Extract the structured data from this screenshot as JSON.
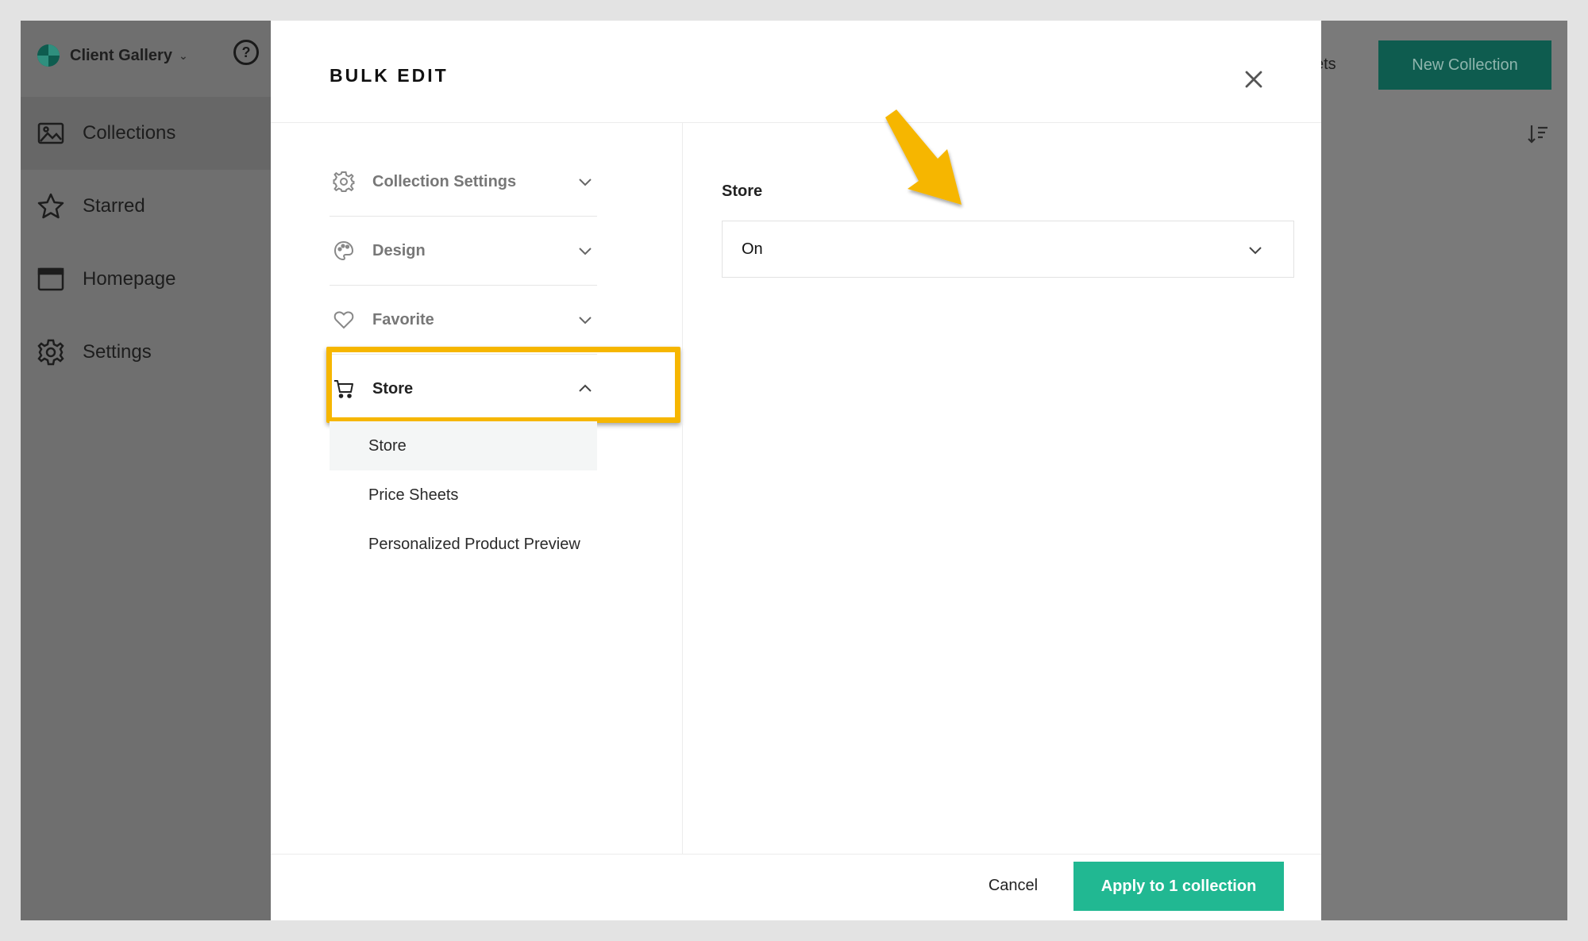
{
  "app": {
    "brand_name": "Client Gallery",
    "help_label": "?",
    "nav": [
      {
        "label": "Collections",
        "icon": "image-folder-icon",
        "active": true
      },
      {
        "label": "Starred",
        "icon": "star-icon",
        "active": false
      },
      {
        "label": "Homepage",
        "icon": "browser-window-icon",
        "active": false
      },
      {
        "label": "Settings",
        "icon": "gear-icon",
        "active": false
      }
    ],
    "top_partial_text": "ets",
    "new_collection_label": "New Collection"
  },
  "modal": {
    "title": "BULK EDIT",
    "menu": [
      {
        "label": "Collection Settings",
        "icon": "gear-icon",
        "expanded": false
      },
      {
        "label": "Design",
        "icon": "palette-icon",
        "expanded": false
      },
      {
        "label": "Favorite",
        "icon": "heart-icon",
        "expanded": false
      },
      {
        "label": "Store",
        "icon": "cart-icon",
        "expanded": true
      }
    ],
    "submenu": [
      {
        "label": "Store",
        "active": true
      },
      {
        "label": "Price Sheets",
        "active": false
      },
      {
        "label": "Personalized Product Preview",
        "active": false
      }
    ],
    "field": {
      "label": "Store",
      "value": "On"
    },
    "footer": {
      "cancel_label": "Cancel",
      "apply_label": "Apply to 1 collection"
    }
  },
  "colors": {
    "accent": "#21b892",
    "highlight": "#f6b600",
    "brand_dark": "#0e5c4f"
  }
}
